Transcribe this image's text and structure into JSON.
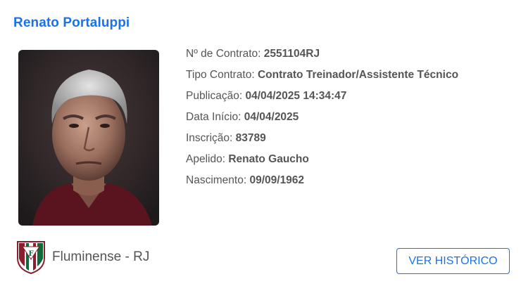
{
  "coach": {
    "name": "Renato Portaluppi"
  },
  "details": [
    {
      "label": "Nº de Contrato:",
      "value": "2551104RJ"
    },
    {
      "label": "Tipo Contrato:",
      "value": "Contrato Treinador/Assistente Técnico"
    },
    {
      "label": "Publicação:",
      "value": "04/04/2025 14:34:47"
    },
    {
      "label": "Data Início:",
      "value": "04/04/2025"
    },
    {
      "label": "Inscrição:",
      "value": "83789"
    },
    {
      "label": "Apelido:",
      "value": "Renato Gaucho"
    },
    {
      "label": "Nascimento:",
      "value": "09/09/1962"
    }
  ],
  "club": {
    "name": "Fluminense - RJ",
    "crest_icon": "fluminense-crest-icon",
    "colors": {
      "garnet": "#8b1d2c",
      "green": "#0d6b3a",
      "white": "#ffffff"
    }
  },
  "actions": {
    "history_label": "VER HISTÓRICO"
  },
  "colors": {
    "accent": "#1a73e8",
    "text": "#555555",
    "background": "#ffffff"
  }
}
